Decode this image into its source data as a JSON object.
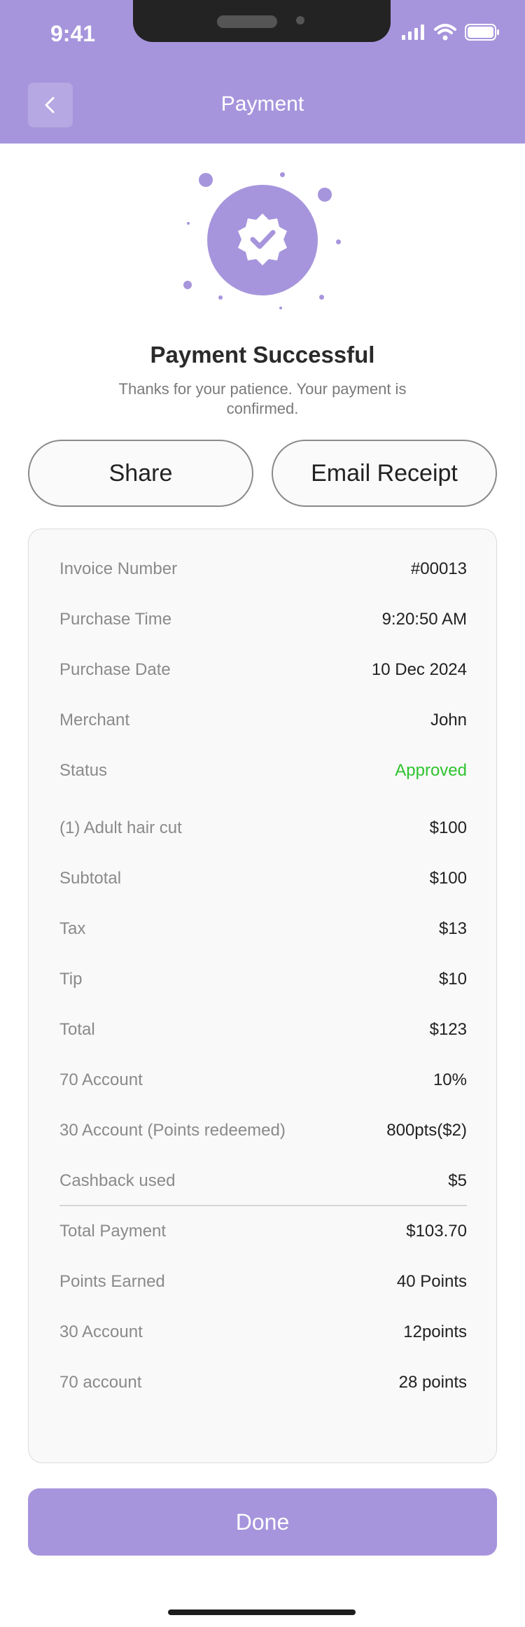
{
  "status_bar": {
    "time": "9:41"
  },
  "header": {
    "title": "Payment"
  },
  "success": {
    "title": "Payment Successful",
    "subtitle": "Thanks for your patience. Your payment is confirmed."
  },
  "actions": {
    "share_label": "Share",
    "email_label": "Email Receipt"
  },
  "receipt": {
    "rows": [
      {
        "label": "Invoice Number",
        "value": "#00013"
      },
      {
        "label": "Purchase Time",
        "value": "9:20:50 AM"
      },
      {
        "label": "Purchase Date",
        "value": "10 Dec 2024"
      },
      {
        "label": "Merchant",
        "value": "John"
      },
      {
        "label": "Status",
        "value": "Approved"
      },
      {
        "label": "(1) Adult hair cut",
        "value": "$100"
      },
      {
        "label": "Subtotal",
        "value": "$100"
      },
      {
        "label": "Tax",
        "value": "$13"
      },
      {
        "label": "Tip",
        "value": "$10"
      },
      {
        "label": "Total",
        "value": "$123"
      },
      {
        "label": "70 Account",
        "value": "10%"
      },
      {
        "label": "30 Account (Points redeemed)",
        "value": "800pts($2)"
      },
      {
        "label": "Cashback used",
        "value": "$5"
      },
      {
        "label": "Total Payment",
        "value": "$103.70"
      },
      {
        "label": "Points Earned",
        "value": "40 Points"
      },
      {
        "label": "30 Account",
        "value": "12points"
      },
      {
        "label": "70 account",
        "value": "28 points"
      }
    ]
  },
  "footer": {
    "done_label": "Done"
  },
  "colors": {
    "accent": "#a695dc",
    "approved": "#2ec42e"
  },
  "icons": [
    "back-chevron-icon",
    "signal-icon",
    "wifi-icon",
    "battery-icon",
    "verified-badge-icon"
  ]
}
